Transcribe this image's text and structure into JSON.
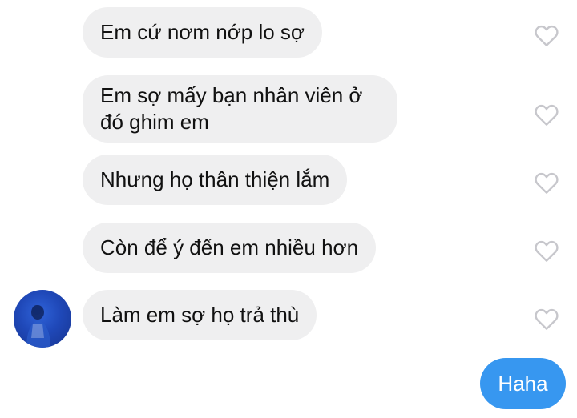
{
  "conversation": {
    "received_messages": [
      {
        "text": "Em cứ nơm nớp lo sợ"
      },
      {
        "text": "Em sợ mấy bạn nhân viên ở đó ghim em"
      },
      {
        "text": "Nhưng họ thân thiện lắm"
      },
      {
        "text": "Còn để ý đến em nhiều hơn"
      },
      {
        "text": "Làm em sợ họ trả thù"
      }
    ],
    "sent_messages": [
      {
        "text": "Haha"
      }
    ]
  },
  "icons": {
    "like": "heart-outline-icon",
    "avatar": "profile-photo"
  },
  "colors": {
    "received_bubble": "#efeff0",
    "sent_bubble": "#3797f0",
    "heart_outline": "#c7c7cc",
    "avatar_background": "#2f63d9"
  }
}
